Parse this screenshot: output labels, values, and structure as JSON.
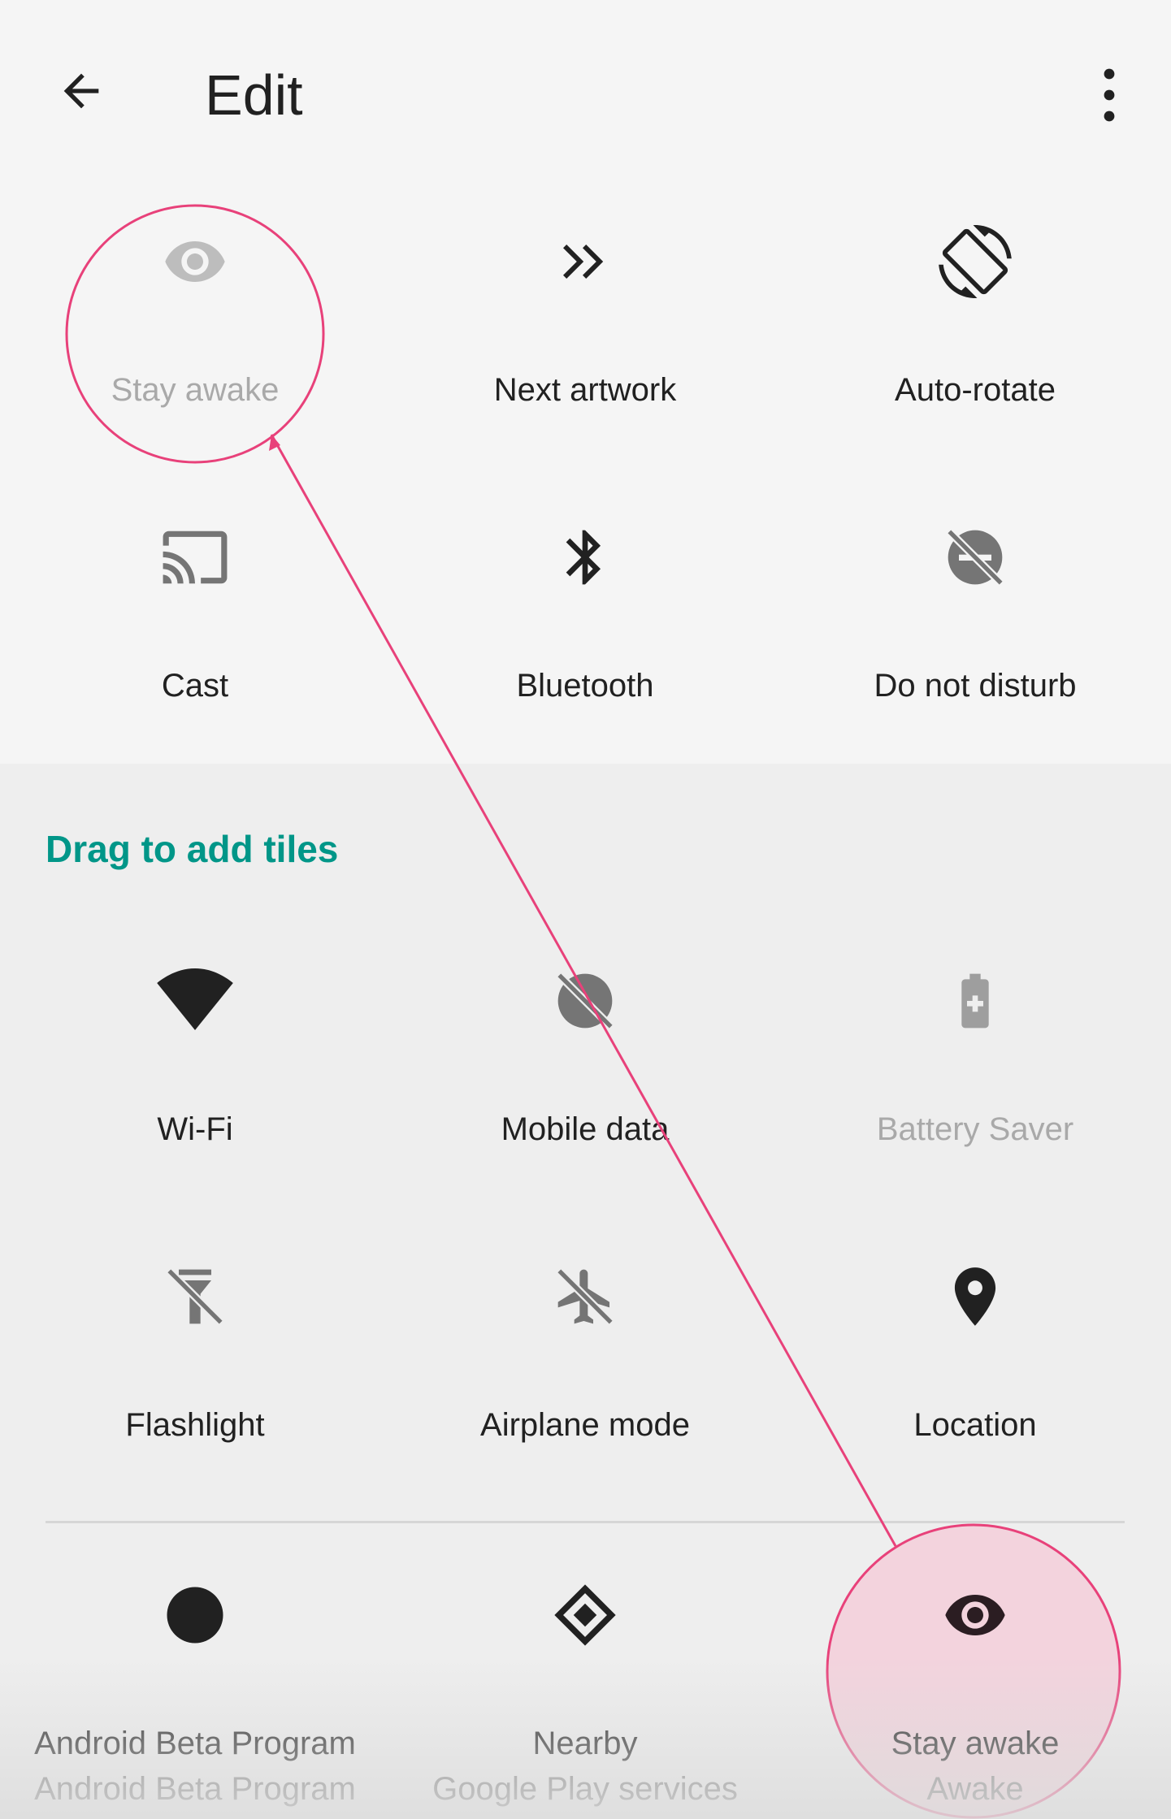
{
  "app": {
    "title": "Edit"
  },
  "toolbar": {
    "back_icon": "arrow-back-icon",
    "overflow_icon": "more-vert-icon"
  },
  "current_tiles": [
    {
      "label": "Stay awake",
      "icon": "eye-icon",
      "dimmed": true
    },
    {
      "label": "Next artwork",
      "icon": "double-chevron-icon"
    },
    {
      "label": "Auto-rotate",
      "icon": "screen-rotation-icon"
    },
    {
      "label": "Cast",
      "icon": "cast-icon",
      "dimmed": false
    },
    {
      "label": "Bluetooth",
      "icon": "bluetooth-icon"
    },
    {
      "label": "Do not disturb",
      "icon": "do-not-disturb-off-icon"
    }
  ],
  "available": {
    "heading": "Drag to add tiles",
    "tiles": [
      {
        "label": "Wi-Fi",
        "icon": "wifi-icon"
      },
      {
        "label": "Mobile data",
        "icon": "mobile-data-off-icon"
      },
      {
        "label": "Battery Saver",
        "icon": "battery-plus-icon",
        "dimmed": true
      },
      {
        "label": "Flashlight",
        "icon": "flashlight-off-icon"
      },
      {
        "label": "Airplane mode",
        "icon": "airplane-off-icon"
      },
      {
        "label": "Location",
        "icon": "location-pin-icon"
      }
    ],
    "app_tiles": [
      {
        "label": "Android Beta Program",
        "sub": "Android Beta Program",
        "icon": "filled-circle-icon"
      },
      {
        "label": "Nearby",
        "sub": "Google Play services",
        "icon": "nearby-diamond-icon"
      },
      {
        "label": "Stay awake",
        "sub": "Awake",
        "icon": "eye-icon"
      }
    ]
  },
  "colors": {
    "accent": "#009688",
    "annotation": "#e8417a",
    "annotation_fill": "#f3d3dd",
    "icon_dark": "#212121",
    "icon_gray": "#757575",
    "icon_light": "#bdbdbd"
  }
}
